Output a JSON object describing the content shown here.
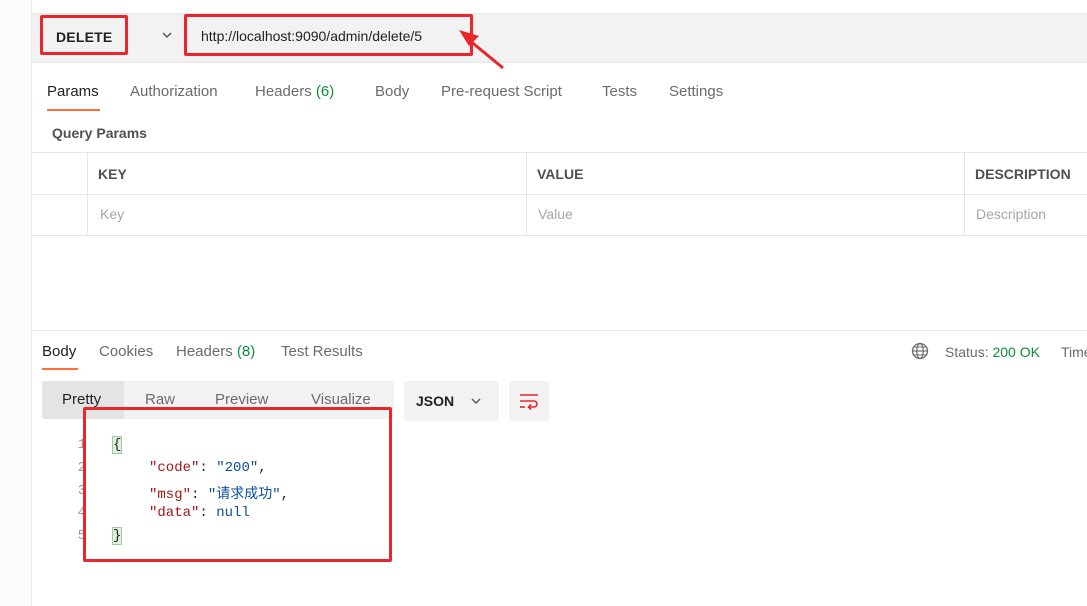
{
  "request": {
    "method": "DELETE",
    "url": "http://localhost:9090/admin/delete/5"
  },
  "request_tabs": [
    {
      "label": "Params",
      "count": ""
    },
    {
      "label": "Authorization",
      "count": ""
    },
    {
      "label": "Headers",
      "count": "(6)"
    },
    {
      "label": "Body",
      "count": ""
    },
    {
      "label": "Pre-request Script",
      "count": ""
    },
    {
      "label": "Tests",
      "count": ""
    },
    {
      "label": "Settings",
      "count": ""
    }
  ],
  "query_params": {
    "title": "Query Params",
    "columns": [
      "KEY",
      "VALUE",
      "DESCRIPTION"
    ],
    "placeholders": [
      "Key",
      "Value",
      "Description"
    ]
  },
  "response_tabs": [
    {
      "label": "Body",
      "count": ""
    },
    {
      "label": "Cookies",
      "count": ""
    },
    {
      "label": "Headers",
      "count": "(8)"
    },
    {
      "label": "Test Results",
      "count": ""
    }
  ],
  "status": {
    "label": "Status:",
    "value": "200 OK",
    "time_label": "Time"
  },
  "view_modes": [
    "Pretty",
    "Raw",
    "Preview",
    "Visualize"
  ],
  "format": "JSON",
  "code_lines": {
    "numbers": [
      "1",
      "2",
      "3",
      "4",
      "5"
    ],
    "open": "{",
    "l2_key": "\"code\"",
    "l2_val": "\"200\"",
    "l3_key": "\"msg\"",
    "l3_val": "\"请求成功\"",
    "l4_key": "\"data\"",
    "l4_val": "null",
    "close": "}",
    "colon": ": ",
    "comma": ","
  },
  "colors": {
    "accent": "#ff6c37",
    "annotation": "#e9262a",
    "success": "#0b8e3b"
  }
}
